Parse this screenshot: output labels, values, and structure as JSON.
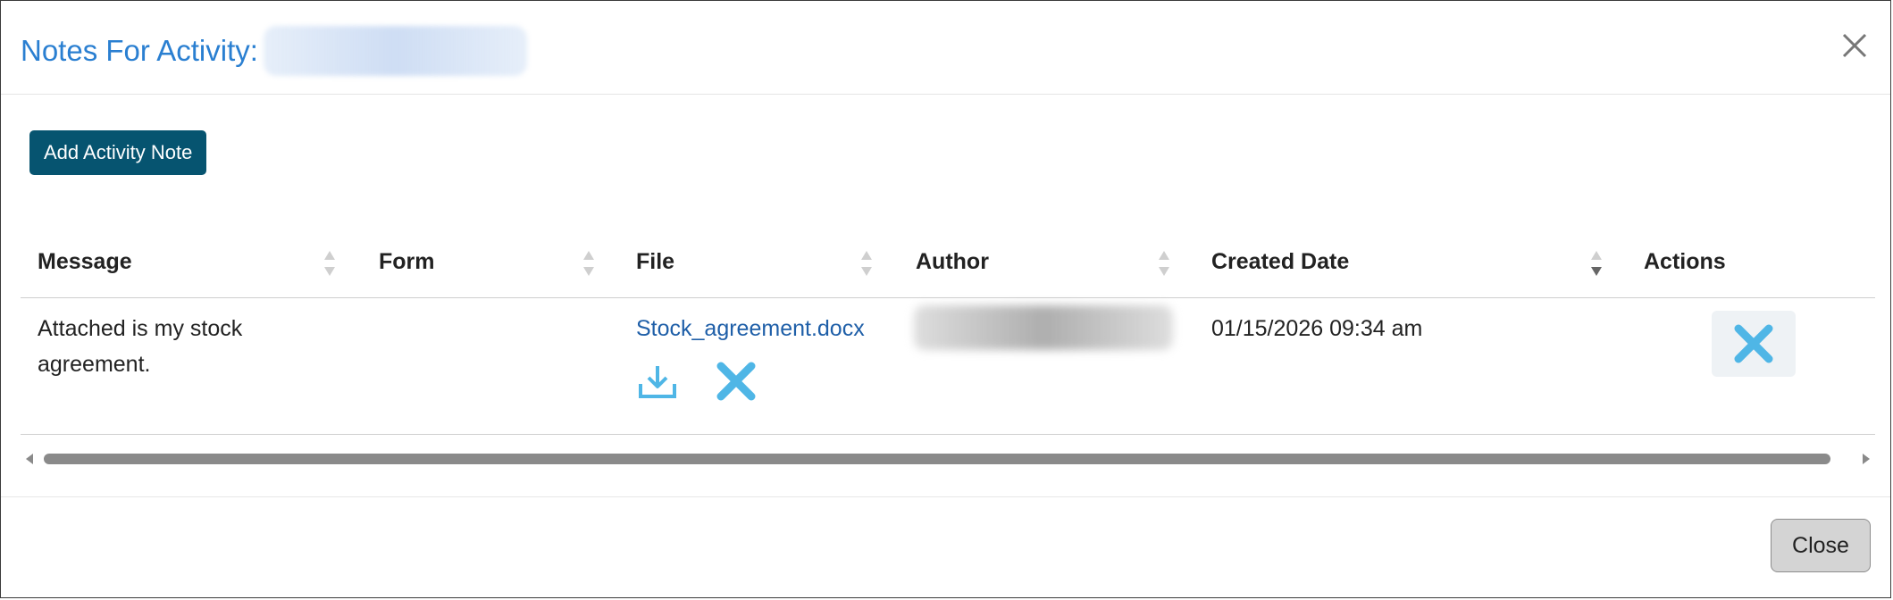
{
  "modal": {
    "title": "Notes For Activity:",
    "close_icon": "close-icon"
  },
  "toolbar": {
    "add_note_label": "Add Activity Note"
  },
  "table": {
    "columns": [
      "Message",
      "Form",
      "File",
      "Author",
      "Created Date",
      "Actions"
    ],
    "sorted_column": "Created Date",
    "rows": [
      {
        "message": "Attached is my stock agreement.",
        "message_line1": "Attached is my stock",
        "message_line2": "agreement.",
        "form": "",
        "file_name": "Stock_agreement.docx",
        "file_icons": [
          "download-icon",
          "delete-icon"
        ],
        "created_date": "01/15/2026 09:34 am",
        "action_icon": "delete-icon"
      }
    ]
  },
  "footer": {
    "close_label": "Close"
  },
  "colors": {
    "title": "#2a7fd1",
    "primary_button": "#065470",
    "link": "#1f5fa8",
    "icon_blue": "#4fb6e6"
  }
}
